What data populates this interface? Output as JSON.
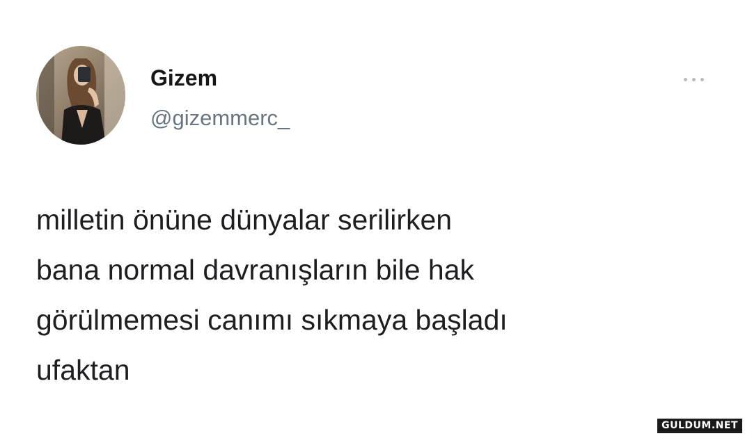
{
  "user": {
    "display_name": "Gizem",
    "handle": "@gizemmerc_"
  },
  "tweet": {
    "text": "milletin önüne dünyalar serilirken\nbana normal davranışların bile hak\ngörülmemesi canımı sıkmaya başladı\nufaktan"
  },
  "icons": {
    "more": "more-options-icon"
  },
  "watermark": {
    "text": "GULDUM.NET"
  },
  "colors": {
    "name": "#14171a",
    "handle": "#66757f",
    "text": "#1c1e21",
    "more_dots": "#b5bcc2"
  }
}
